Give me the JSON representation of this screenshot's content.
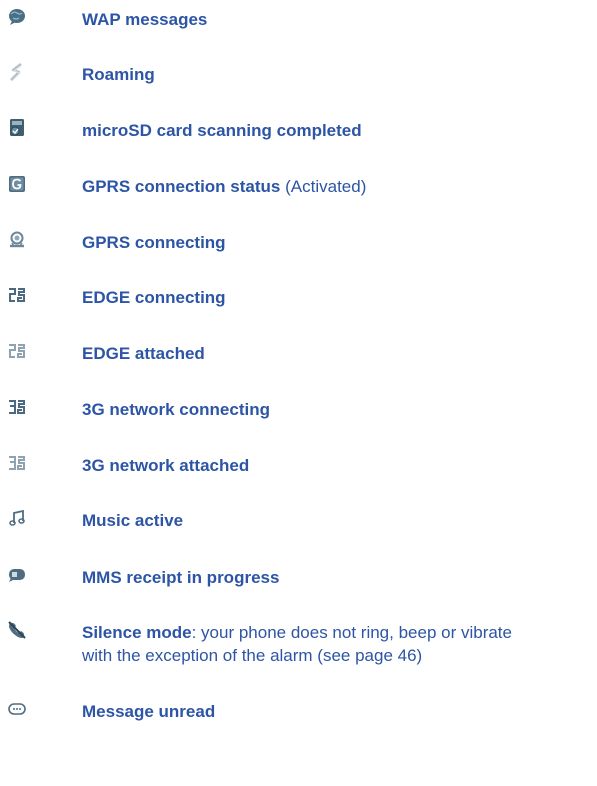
{
  "entries": [
    {
      "icon": "globe-message-icon",
      "title": "WAP messages"
    },
    {
      "icon": "roaming-icon",
      "title": "Roaming"
    },
    {
      "icon": "microsd-card-icon",
      "title": "microSD card scanning completed"
    },
    {
      "icon": "gprs-g-icon",
      "title": "GPRS connection status",
      "detail": "(Activated)"
    },
    {
      "icon": "gprs-connecting-icon",
      "title": "GPRS connecting"
    },
    {
      "icon": "edge-connecting-icon",
      "title": "EDGE connecting"
    },
    {
      "icon": "edge-attached-icon",
      "title": "EDGE attached"
    },
    {
      "icon": "3g-connecting-icon",
      "title": "3G network connecting"
    },
    {
      "icon": "3g-attached-icon",
      "title": "3G network attached"
    },
    {
      "icon": "music-note-icon",
      "title": "Music active"
    },
    {
      "icon": "mms-receipt-icon",
      "title": "MMS receipt in progress"
    },
    {
      "icon": "silence-mode-icon",
      "title": "Silence mode",
      "detail_line1": ": your phone does not ring, beep or vibrate",
      "detail_line2": "with the exception of the alarm (see page 46)"
    },
    {
      "icon": "message-unread-icon",
      "title": "Message unread"
    }
  ]
}
